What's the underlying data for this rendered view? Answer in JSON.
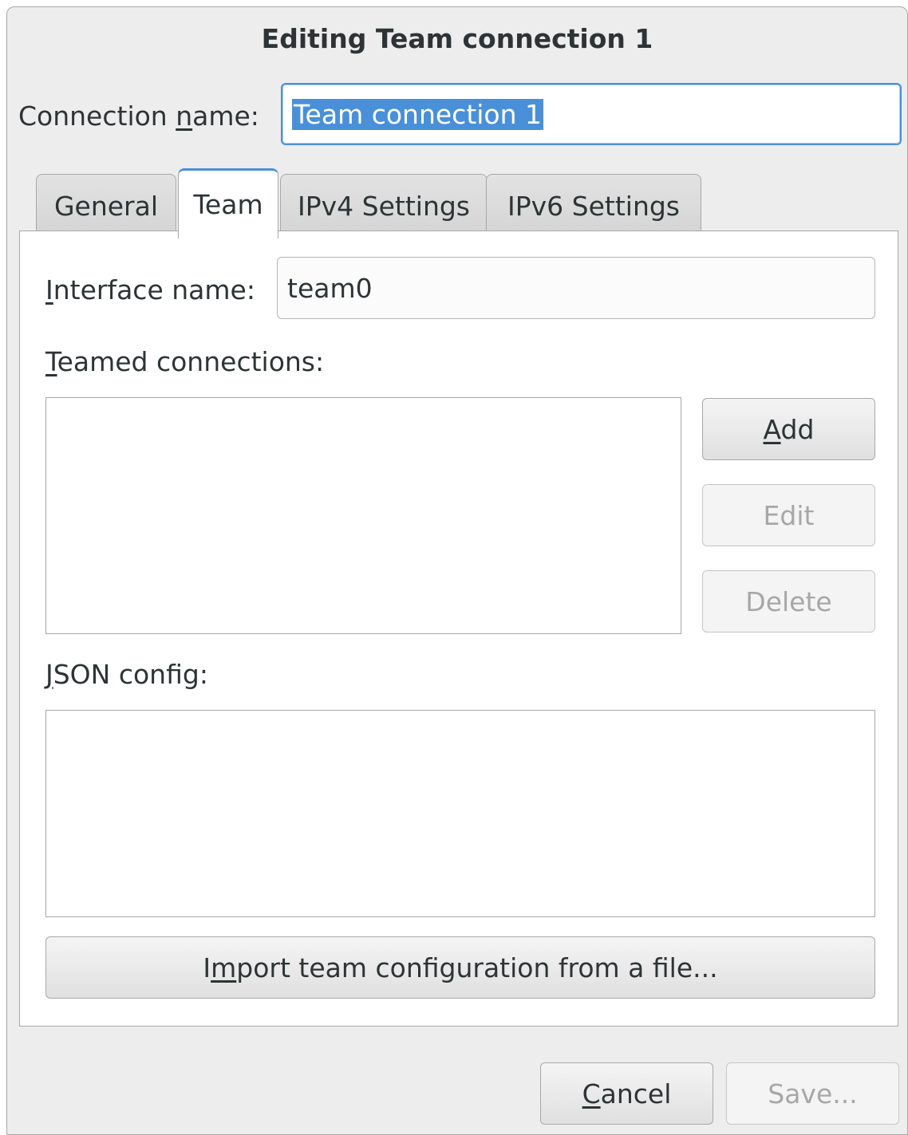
{
  "dialog": {
    "title": "Editing Team connection 1"
  },
  "connection_name": {
    "label_pre": "Connection ",
    "label_mnemonic": "n",
    "label_post": "ame:",
    "value": "Team connection 1"
  },
  "tabs": [
    {
      "label": "General"
    },
    {
      "label": "Team",
      "active": true
    },
    {
      "label": "IPv4 Settings"
    },
    {
      "label": "IPv6 Settings"
    }
  ],
  "team": {
    "interface_label_mnemonic": "I",
    "interface_label_rest": "nterface name:",
    "interface_value": "team0",
    "teamed_label_mnemonic": "T",
    "teamed_label_rest": "eamed connections:",
    "add_mnemonic": "A",
    "add_rest": "dd",
    "edit_label": "Edit",
    "delete_label": "Delete",
    "json_label_mnemonic": "J",
    "json_label_rest": "SON config:",
    "import_pre": "I",
    "import_mnemonic": "m",
    "import_post": "port team configuration from a file..."
  },
  "footer": {
    "cancel_mnemonic": "C",
    "cancel_rest": "ancel",
    "save_label": "Save..."
  },
  "colors": {
    "accent": "#4a90d9",
    "dialog_bg": "#ededed",
    "disabled_text": "#a6a8a6"
  }
}
